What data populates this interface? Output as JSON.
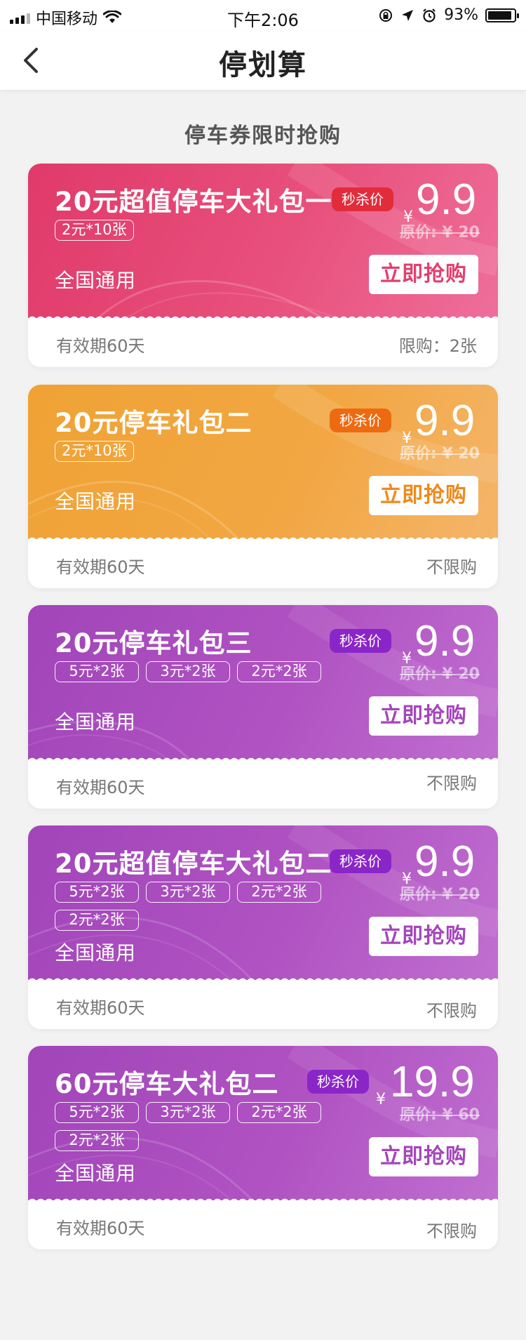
{
  "status_bar": {
    "carrier": "中国移动",
    "time": "下午2:06",
    "battery": "93%",
    "battery_level": 0.93
  },
  "nav": {
    "title": "停划算"
  },
  "section_title": "停车券限时抢购",
  "coupons": [
    {
      "title": "20元超值停车大礼包一",
      "tags": [
        "2元*10张"
      ],
      "scope": "全国通用",
      "seckill": "秒杀价",
      "yen": "¥",
      "price": "9.9",
      "original": "原价: ¥ 20",
      "buy": "立即抢购",
      "validity": "有效期60天",
      "limit": "限购：2张",
      "accent": "#e33f6f",
      "tag_color": "#e22c3c"
    },
    {
      "title": "20元停车礼包二",
      "tags": [
        "2元*10张"
      ],
      "scope": "全国通用",
      "seckill": "秒杀价",
      "yen": "¥",
      "price": "9.9",
      "original": "原价: ¥ 20",
      "buy": "立即抢购",
      "validity": "有效期60天",
      "limit": "不限购",
      "accent": "#ee8a1c",
      "tag_color": "#ee6a10"
    },
    {
      "title": "20元停车礼包三",
      "tags": [
        "5元*2张",
        "3元*2张",
        "2元*2张"
      ],
      "scope": "全国通用",
      "seckill": "秒杀价",
      "yen": "¥",
      "price": "9.9",
      "original": "原价: ¥ 20",
      "buy": "立即抢购",
      "validity": "有效期60天",
      "limit": "不限购",
      "accent": "#a446bb",
      "tag_color": "#8a26c8"
    },
    {
      "title": "20元超值停车大礼包二",
      "tags": [
        "5元*2张",
        "3元*2张",
        "2元*2张",
        "2元*2张"
      ],
      "scope": "全国通用",
      "seckill": "秒杀价",
      "yen": "¥",
      "price": "9.9",
      "original": "原价: ¥ 20",
      "buy": "立即抢购",
      "validity": "有效期60天",
      "limit": "不限购",
      "accent": "#a446bb",
      "tag_color": "#8a26c8"
    },
    {
      "title": "60元停车大礼包二",
      "tags": [
        "5元*2张",
        "3元*2张",
        "2元*2张",
        "2元*2张"
      ],
      "scope": "全国通用",
      "seckill": "秒杀价",
      "yen": "¥",
      "price": "19.9",
      "original": "原价: ¥ 60",
      "buy": "立即抢购",
      "validity": "有效期60天",
      "limit": "不限购",
      "accent": "#a446bb",
      "tag_color": "#8a26c8"
    }
  ]
}
